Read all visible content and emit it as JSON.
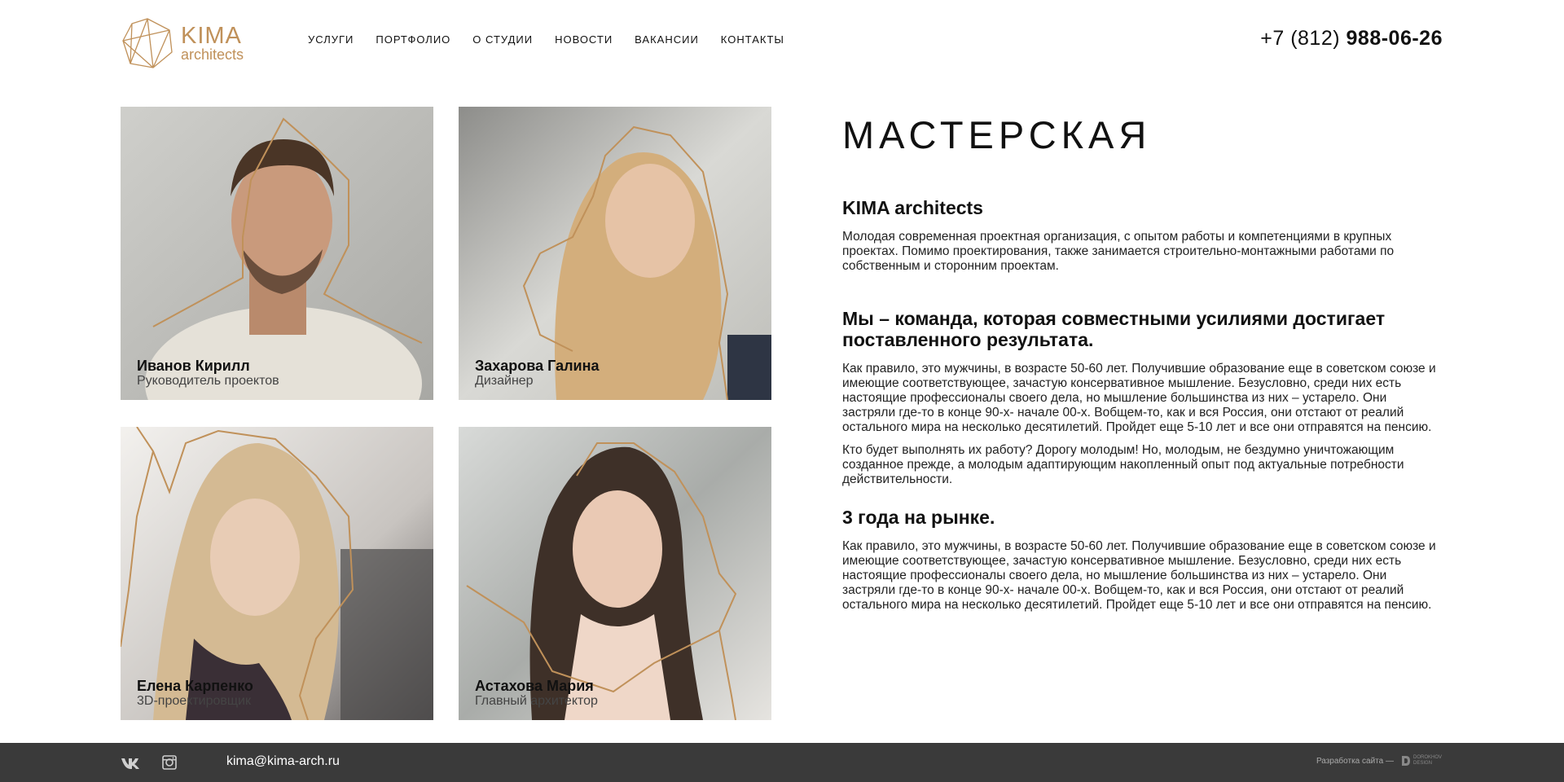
{
  "header": {
    "logo": {
      "word": "KIMA",
      "sub": "architects"
    },
    "nav": [
      "УСЛУГИ",
      "ПОРТФОЛИО",
      "О СТУДИИ",
      "НОВОСТИ",
      "ВАКАНСИИ",
      "КОНТАКТЫ"
    ],
    "phone": {
      "prefix": "+7 (812)",
      "main": "988-06-26"
    }
  },
  "team": [
    {
      "name": "Иванов Кирилл",
      "role": "Руководитель проектов"
    },
    {
      "name": "Захарова Галина",
      "role": "Дизайнер"
    },
    {
      "name": "Елена Карпенко",
      "role": "3D-проектировщик"
    },
    {
      "name": "Астахова Мария",
      "role": "Главный архитектор"
    }
  ],
  "content": {
    "title": "МАСТЕРСКАЯ",
    "sections": [
      {
        "heading": "KIMA architects",
        "paragraphs": [
          "Молодая современная проектная организация, с опытом работы и компетенциями в крупных проектах. Помимо проектирования, также занимается строительно-монтажными работами по собственным и сторонним проектам."
        ]
      },
      {
        "heading": "Мы – команда, которая совместными усилиями достигает поставленного результата.",
        "paragraphs": [
          "Как правило, это мужчины, в возрасте 50-60 лет. Получившие образование еще в советском союзе и имеющие соответствующее, зачастую консервативное мышление. Безусловно, среди них есть настоящие профессионалы своего дела, но мышление большинства из них – устарело. Они застряли где-то в конце 90-х- начале 00-х. Вобщем-то, как и вся Россия, они отстают от реалий остального мира на несколько десятилетий. Пройдет еще 5-10 лет и все они отправятся на пенсию.",
          "Кто будет выполнять их работу? Дорогу молодым! Но, молодым, не бездумно уничтожающим созданное прежде, а молодым адаптирующим накопленный опыт под актуальные потребности действительности."
        ]
      },
      {
        "heading": "3 года на рынке.",
        "paragraphs": [
          "Как правило, это мужчины, в возрасте 50-60 лет. Получившие образование еще в советском союзе и имеющие соответствующее, зачастую консервативное мышление. Безусловно, среди них есть настоящие профессионалы своего дела, но мышление большинства из них – устарело. Они застряли где-то в конце 90-х- начале 00-х. Вобщем-то, как и вся Россия, они отстают от реалий остального мира на несколько десятилетий. Пройдет еще 5-10 лет и все они отправятся на пенсию."
        ]
      }
    ]
  },
  "footer": {
    "email": "kima@kima-arch.ru",
    "dev_label": "Разработка сайта —",
    "dev_brand_line1": "DOROKHOV",
    "dev_brand_line2": "DESIGN",
    "social": [
      "vk-icon",
      "instagram-icon"
    ]
  },
  "colors": {
    "accent": "#c0915a",
    "footer_bg": "#3a3a3a"
  }
}
